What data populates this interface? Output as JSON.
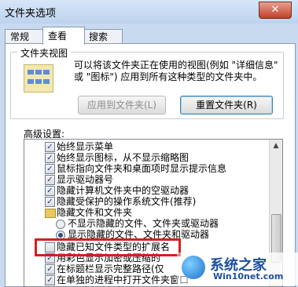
{
  "window": {
    "title": "文件夹选项",
    "close_glyph": "✕"
  },
  "tabs": [
    {
      "label": "常规"
    },
    {
      "label": "查看",
      "active": true
    },
    {
      "label": "搜索"
    }
  ],
  "folder_views": {
    "title": "文件夹视图",
    "description": "可以将该文件夹正在使用的视图(例如 \"详细信息\" 或 \"图标\") 应用到所有这种类型的文件夹中。",
    "apply_button": "应用到文件夹(L)",
    "reset_button": "重置文件夹(R)"
  },
  "advanced": {
    "label": "高级设置:",
    "items": [
      {
        "type": "checkbox",
        "checked": true,
        "label": "始终显示菜单"
      },
      {
        "type": "checkbox",
        "checked": true,
        "label": "始终显示图标，从不显示缩略图"
      },
      {
        "type": "checkbox",
        "checked": true,
        "label": "鼠标指向文件夹和桌面项时显示提示信息"
      },
      {
        "type": "checkbox",
        "checked": true,
        "label": "显示驱动器号"
      },
      {
        "type": "checkbox",
        "checked": true,
        "label": "隐藏计算机文件夹中的空驱动器"
      },
      {
        "type": "checkbox",
        "checked": true,
        "label": "隐藏受保护的操作系统文件(推荐)"
      },
      {
        "type": "folder",
        "label": "隐藏文件和文件夹"
      },
      {
        "type": "radio",
        "checked": false,
        "label": "不显示隐藏的文件、文件夹或驱动器"
      },
      {
        "type": "radio",
        "checked": true,
        "label": "显示隐藏的文件、文件夹和驱动器"
      },
      {
        "type": "checkbox",
        "checked": false,
        "label": "隐藏已知文件类型的扩展名"
      },
      {
        "type": "checkbox",
        "checked": true,
        "label": "用彩色显示加密或压缩的"
      },
      {
        "type": "checkbox",
        "checked": true,
        "label": "在标题栏显示完整路径(仅"
      },
      {
        "type": "checkbox",
        "checked": true,
        "label": "在单独的进程中打开文件夹窗口"
      }
    ]
  },
  "watermark": {
    "main": "系统之家",
    "sub": "Win10net.com"
  }
}
